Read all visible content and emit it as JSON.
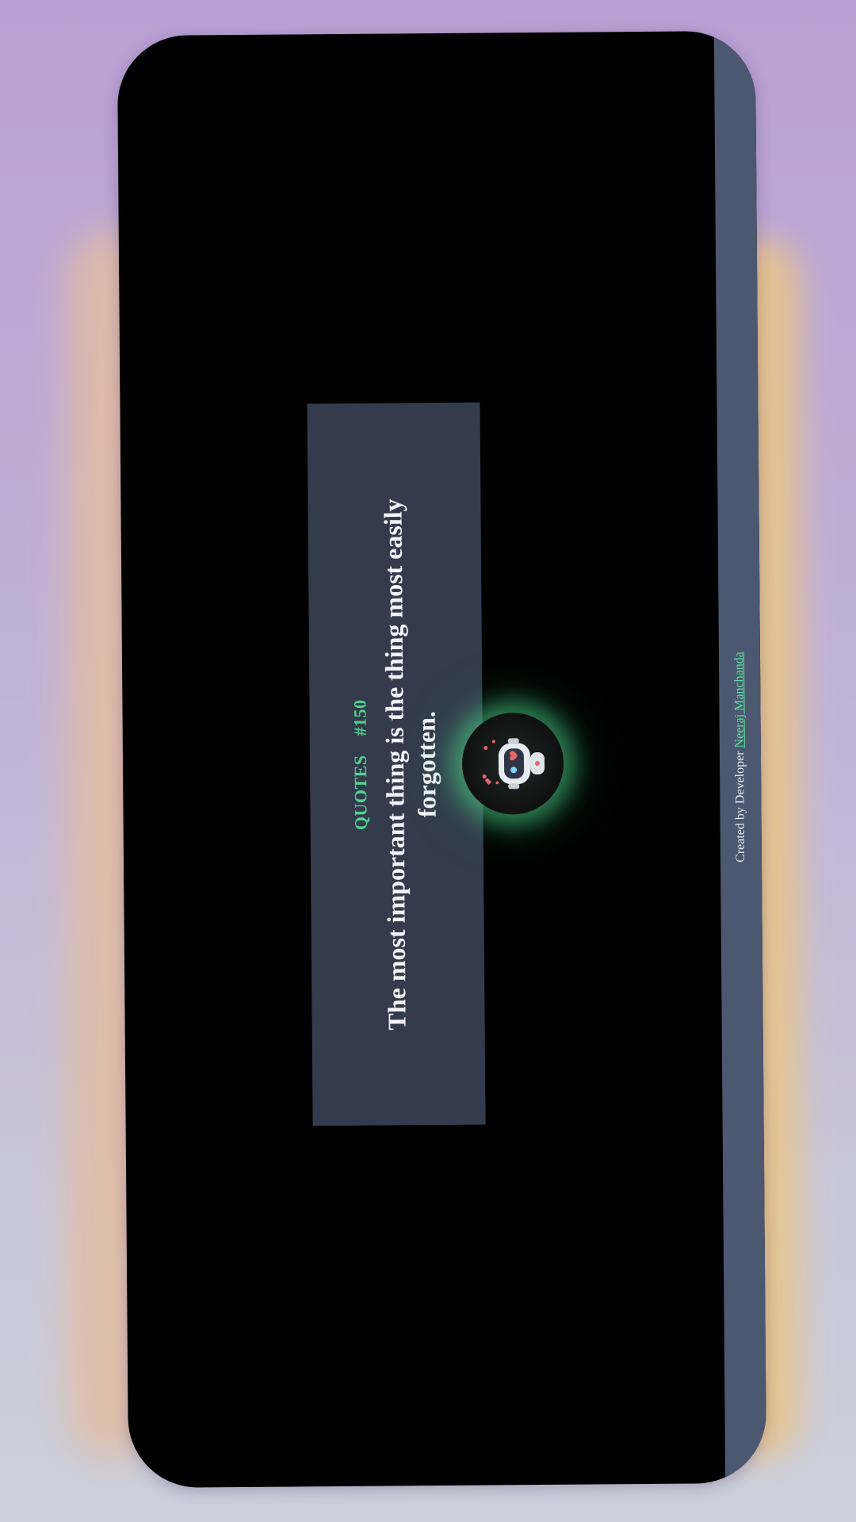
{
  "quote": {
    "label": "QUOTES",
    "number": "#150",
    "text": "The most important thing is the thing most easily forgotten."
  },
  "footer": {
    "prefix": "Created by Developer",
    "author": "Neeraj Manchanda"
  },
  "colors": {
    "accent": "#4fd48f",
    "card": "#343b4c",
    "footer_bar": "#4b5870",
    "screen": "#000000"
  },
  "icons": {
    "avatar": "robot-with-hearts-icon"
  }
}
